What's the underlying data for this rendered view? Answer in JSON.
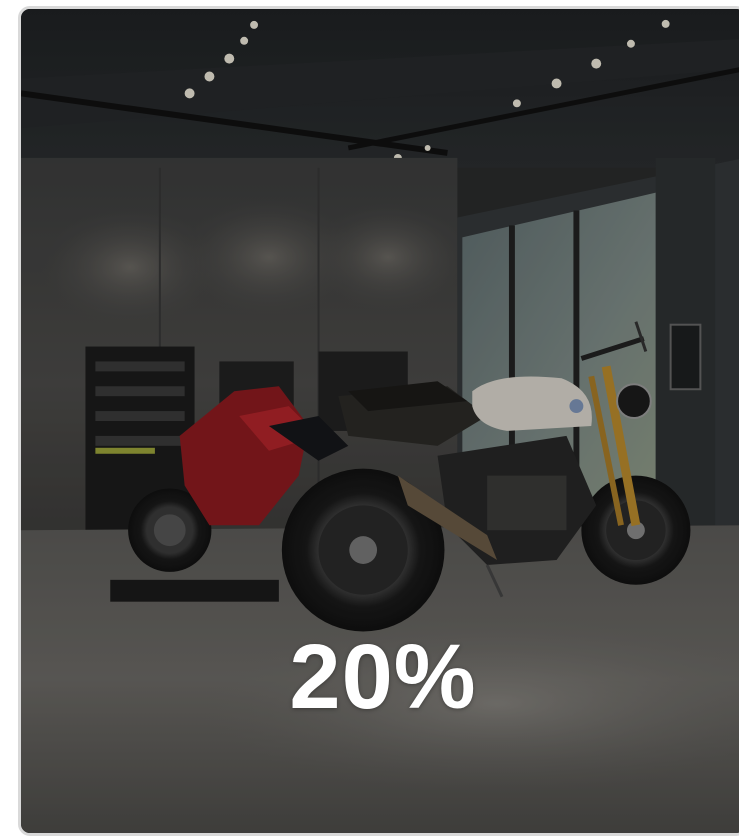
{
  "promo_card": {
    "discount_label": "20%",
    "image_subject": "motorcycle-showroom",
    "colors": {
      "text": "#ffffff",
      "card_border": "#d9d9d9",
      "overlay": "rgba(0,0,0,0.18)"
    }
  }
}
